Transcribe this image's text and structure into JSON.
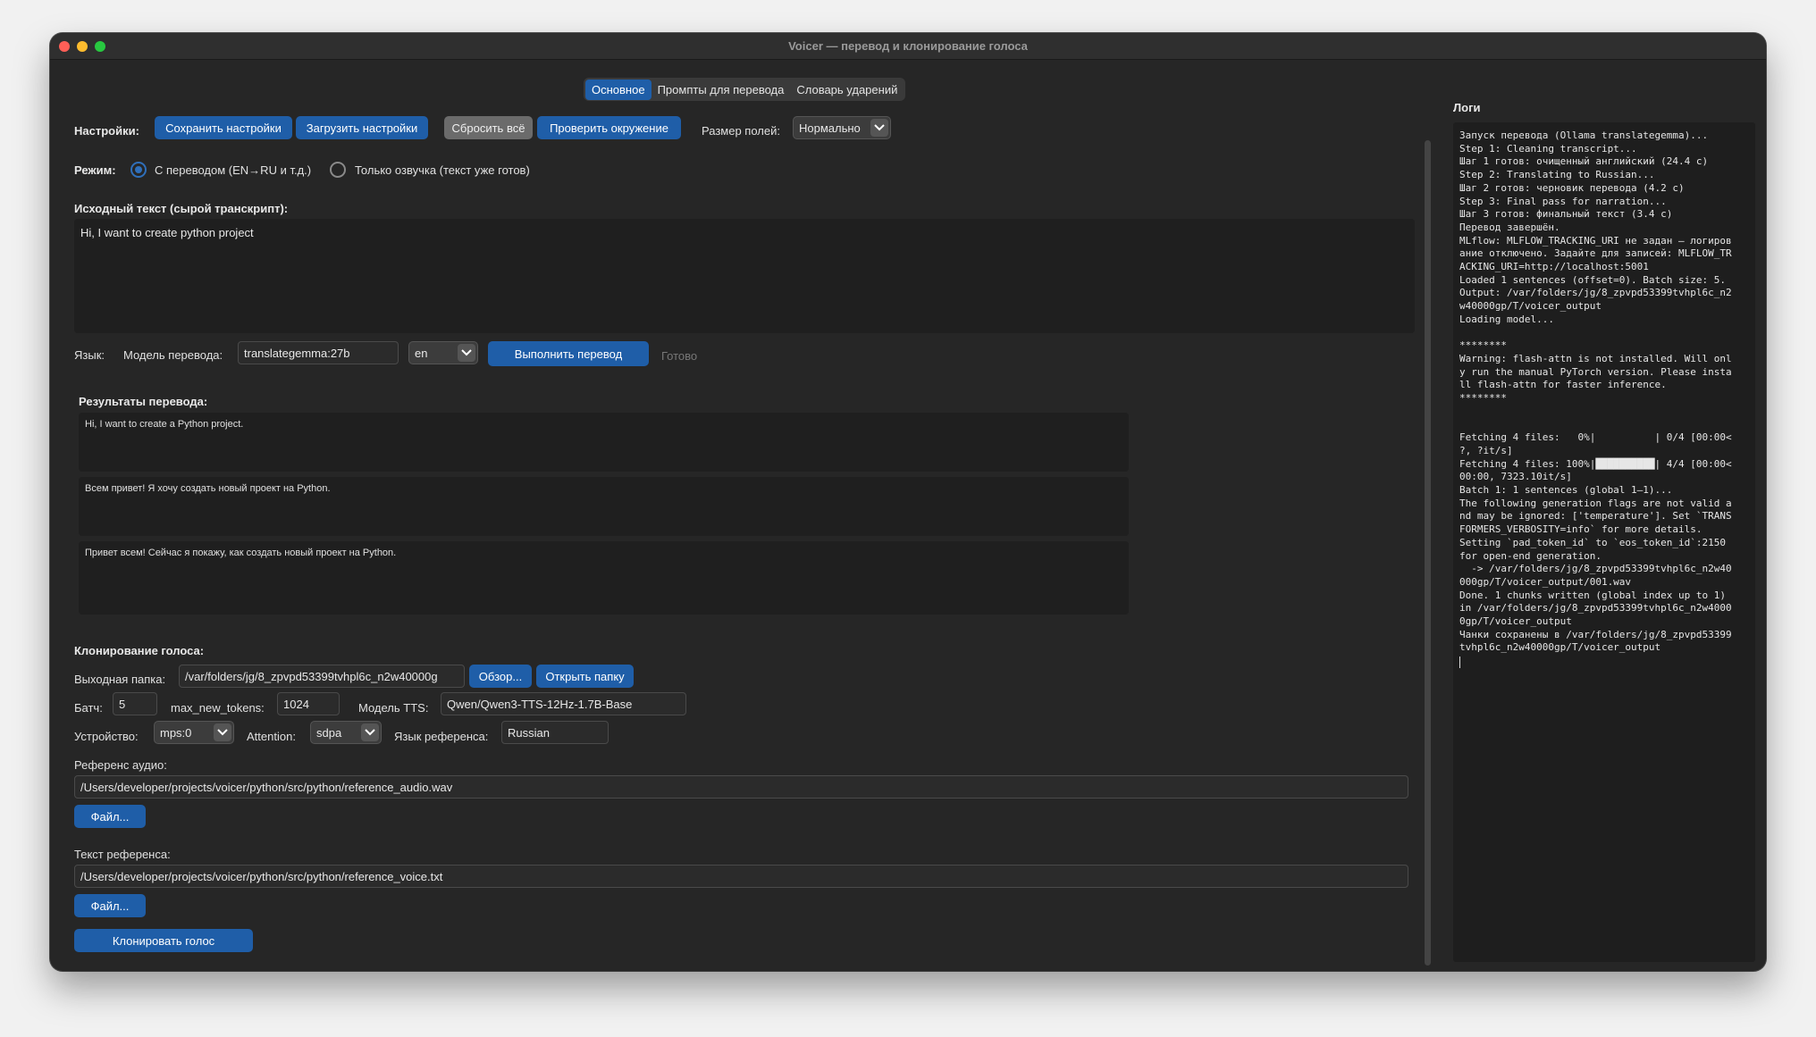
{
  "window": {
    "title": "Voicer — перевод и клонирование голоса"
  },
  "tabs": [
    "Основное",
    "Промпты для перевода",
    "Словарь ударений"
  ],
  "settings": {
    "label": "Настройки:",
    "save": "Сохранить настройки",
    "load": "Загрузить настройки",
    "reset": "Сбросить всё",
    "check_env": "Проверить окружение",
    "field_size_label": "Размер полей:",
    "field_size_value": "Нормально"
  },
  "mode": {
    "label": "Режим:",
    "with_translation": "С переводом (EN→RU и т.д.)",
    "voice_only": "Только озвучка (текст уже готов)",
    "selected": "with_translation"
  },
  "source": {
    "label": "Исходный текст (сырой транскрипт):",
    "text": "Hi, I want to create python project"
  },
  "translation": {
    "lang_label": "Язык:",
    "model_label": "Модель перевода:",
    "model_value": "translategemma:27b",
    "lang_value": "en",
    "run_button": "Выполнить перевод",
    "status": "Готово"
  },
  "results": {
    "label": "Результаты перевода:",
    "items": [
      "Hi, I want to create a Python project.",
      "Всем привет! Я хочу создать новый проект на Python.",
      "Привет всем! Сейчас я покажу, как создать новый проект на Python."
    ]
  },
  "clone": {
    "label": "Клонирование голоса:",
    "output_label": "Выходная папка:",
    "output_value": "/var/folders/jg/8_zpvpd53399tvhpl6c_n2w40000g",
    "browse": "Обзор...",
    "open_folder": "Открыть папку",
    "batch_label": "Батч:",
    "batch_value": "5",
    "max_tokens_label": "max_new_tokens:",
    "max_tokens_value": "1024",
    "tts_model_label": "Модель TTS:",
    "tts_model_value": "Qwen/Qwen3-TTS-12Hz-1.7B-Base",
    "device_label": "Устройство:",
    "device_value": "mps:0",
    "attention_label": "Attention:",
    "attention_value": "sdpa",
    "ref_lang_label": "Язык референса:",
    "ref_lang_value": "Russian",
    "ref_audio_label": "Референс аудио:",
    "ref_audio_value": "/Users/developer/projects/voicer/python/src/python/reference_audio.wav",
    "file_button": "Файл...",
    "ref_text_label": "Текст референса:",
    "ref_text_value": "/Users/developer/projects/voicer/python/src/python/reference_voice.txt",
    "file_button2": "Файл...",
    "clone_button": "Клонировать голос"
  },
  "logs": {
    "title": "Логи",
    "lines": [
      "Запуск перевода (Ollama translategemma)...",
      "Step 1: Cleaning transcript...",
      "Шаг 1 готов: очищенный английский (24.4 с)",
      "Step 2: Translating to Russian...",
      "Шаг 2 готов: черновик перевода (4.2 с)",
      "Step 3: Final pass for narration...",
      "Шаг 3 готов: финальный текст (3.4 с)",
      "Перевод завершён.",
      "MLflow: MLFLOW_TRACKING_URI не задан — логиров",
      "ание отключено. Задайте для записей: MLFLOW_TR",
      "ACKING_URI=http://localhost:5001",
      "Loaded 1 sentences (offset=0). Batch size: 5.",
      "Output: /var/folders/jg/8_zpvpd53399tvhpl6c_n2",
      "w40000gp/T/voicer_output",
      "Loading model...",
      "",
      "********",
      "Warning: flash-attn is not installed. Will onl",
      "y run the manual PyTorch version. Please insta",
      "ll flash-attn for faster inference.",
      "********",
      "",
      "",
      "Fetching 4 files:   0%|          | 0/4 [00:00<",
      "?, ?it/s]",
      "Fetching 4 files: 100%|██████████| 4/4 [00:00<",
      "00:00, 7323.10it/s]",
      "Batch 1: 1 sentences (global 1–1)...",
      "The following generation flags are not valid a",
      "nd may be ignored: ['temperature']. Set `TRANS",
      "FORMERS_VERBOSITY=info` for more details.",
      "Setting `pad_token_id` to `eos_token_id`:2150",
      "for open-end generation.",
      "  -> /var/folders/jg/8_zpvpd53399tvhpl6c_n2w40",
      "000gp/T/voicer_output/001.wav",
      "Done. 1 chunks written (global index up to 1)",
      "in /var/folders/jg/8_zpvpd53399tvhpl6c_n2w4000",
      "0gp/T/voicer_output",
      "Чанки сохранены в /var/folders/jg/8_zpvpd53399",
      "tvhpl6c_n2w40000gp/T/voicer_output"
    ]
  }
}
